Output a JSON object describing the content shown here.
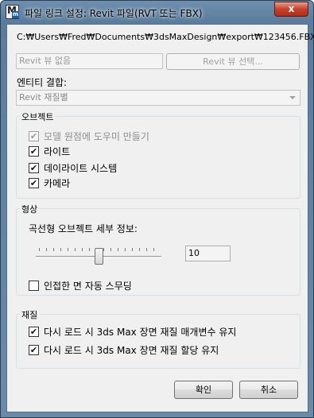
{
  "window": {
    "title": "파일 링크 설정: Revit 파일(RVT 또는 FBX)",
    "close_label": "x"
  },
  "file_path": "C:₩Users₩Fred₩Documents₩3dsMaxDesign₩export₩123456.FBX",
  "revit_view": {
    "field_value": "Revit 뷰 없음",
    "select_button_label": "Revit 뷰 선택..."
  },
  "entity_combine": {
    "label": "엔티티 결합:",
    "selected": "Revit 재질별"
  },
  "objects_group": {
    "title": "오브젝트",
    "items": [
      {
        "label": "모델 원점에 도우미 만들기",
        "checked": true,
        "disabled": true
      },
      {
        "label": "라이트",
        "checked": true,
        "disabled": false
      },
      {
        "label": "데이라이트 시스템",
        "checked": true,
        "disabled": false
      },
      {
        "label": "카메라",
        "checked": true,
        "disabled": false
      }
    ]
  },
  "geometry_group": {
    "title": "형상",
    "curve_detail_label": "곡선형 오브젝트 세부 정보:",
    "curve_detail_value": "10",
    "smooth_label": "인접한 면 자동 스무딩",
    "smooth_checked": false
  },
  "material_group": {
    "title": "재질",
    "items": [
      {
        "label": "다시 로드 시 3ds Max 장면 재질 매개변수 유지",
        "checked": true
      },
      {
        "label": "다시 로드 시 3ds Max 장면 재질 할당 유지",
        "checked": true
      }
    ]
  },
  "buttons": {
    "ok": "확인",
    "cancel": "취소"
  },
  "check_glyph": "✔"
}
